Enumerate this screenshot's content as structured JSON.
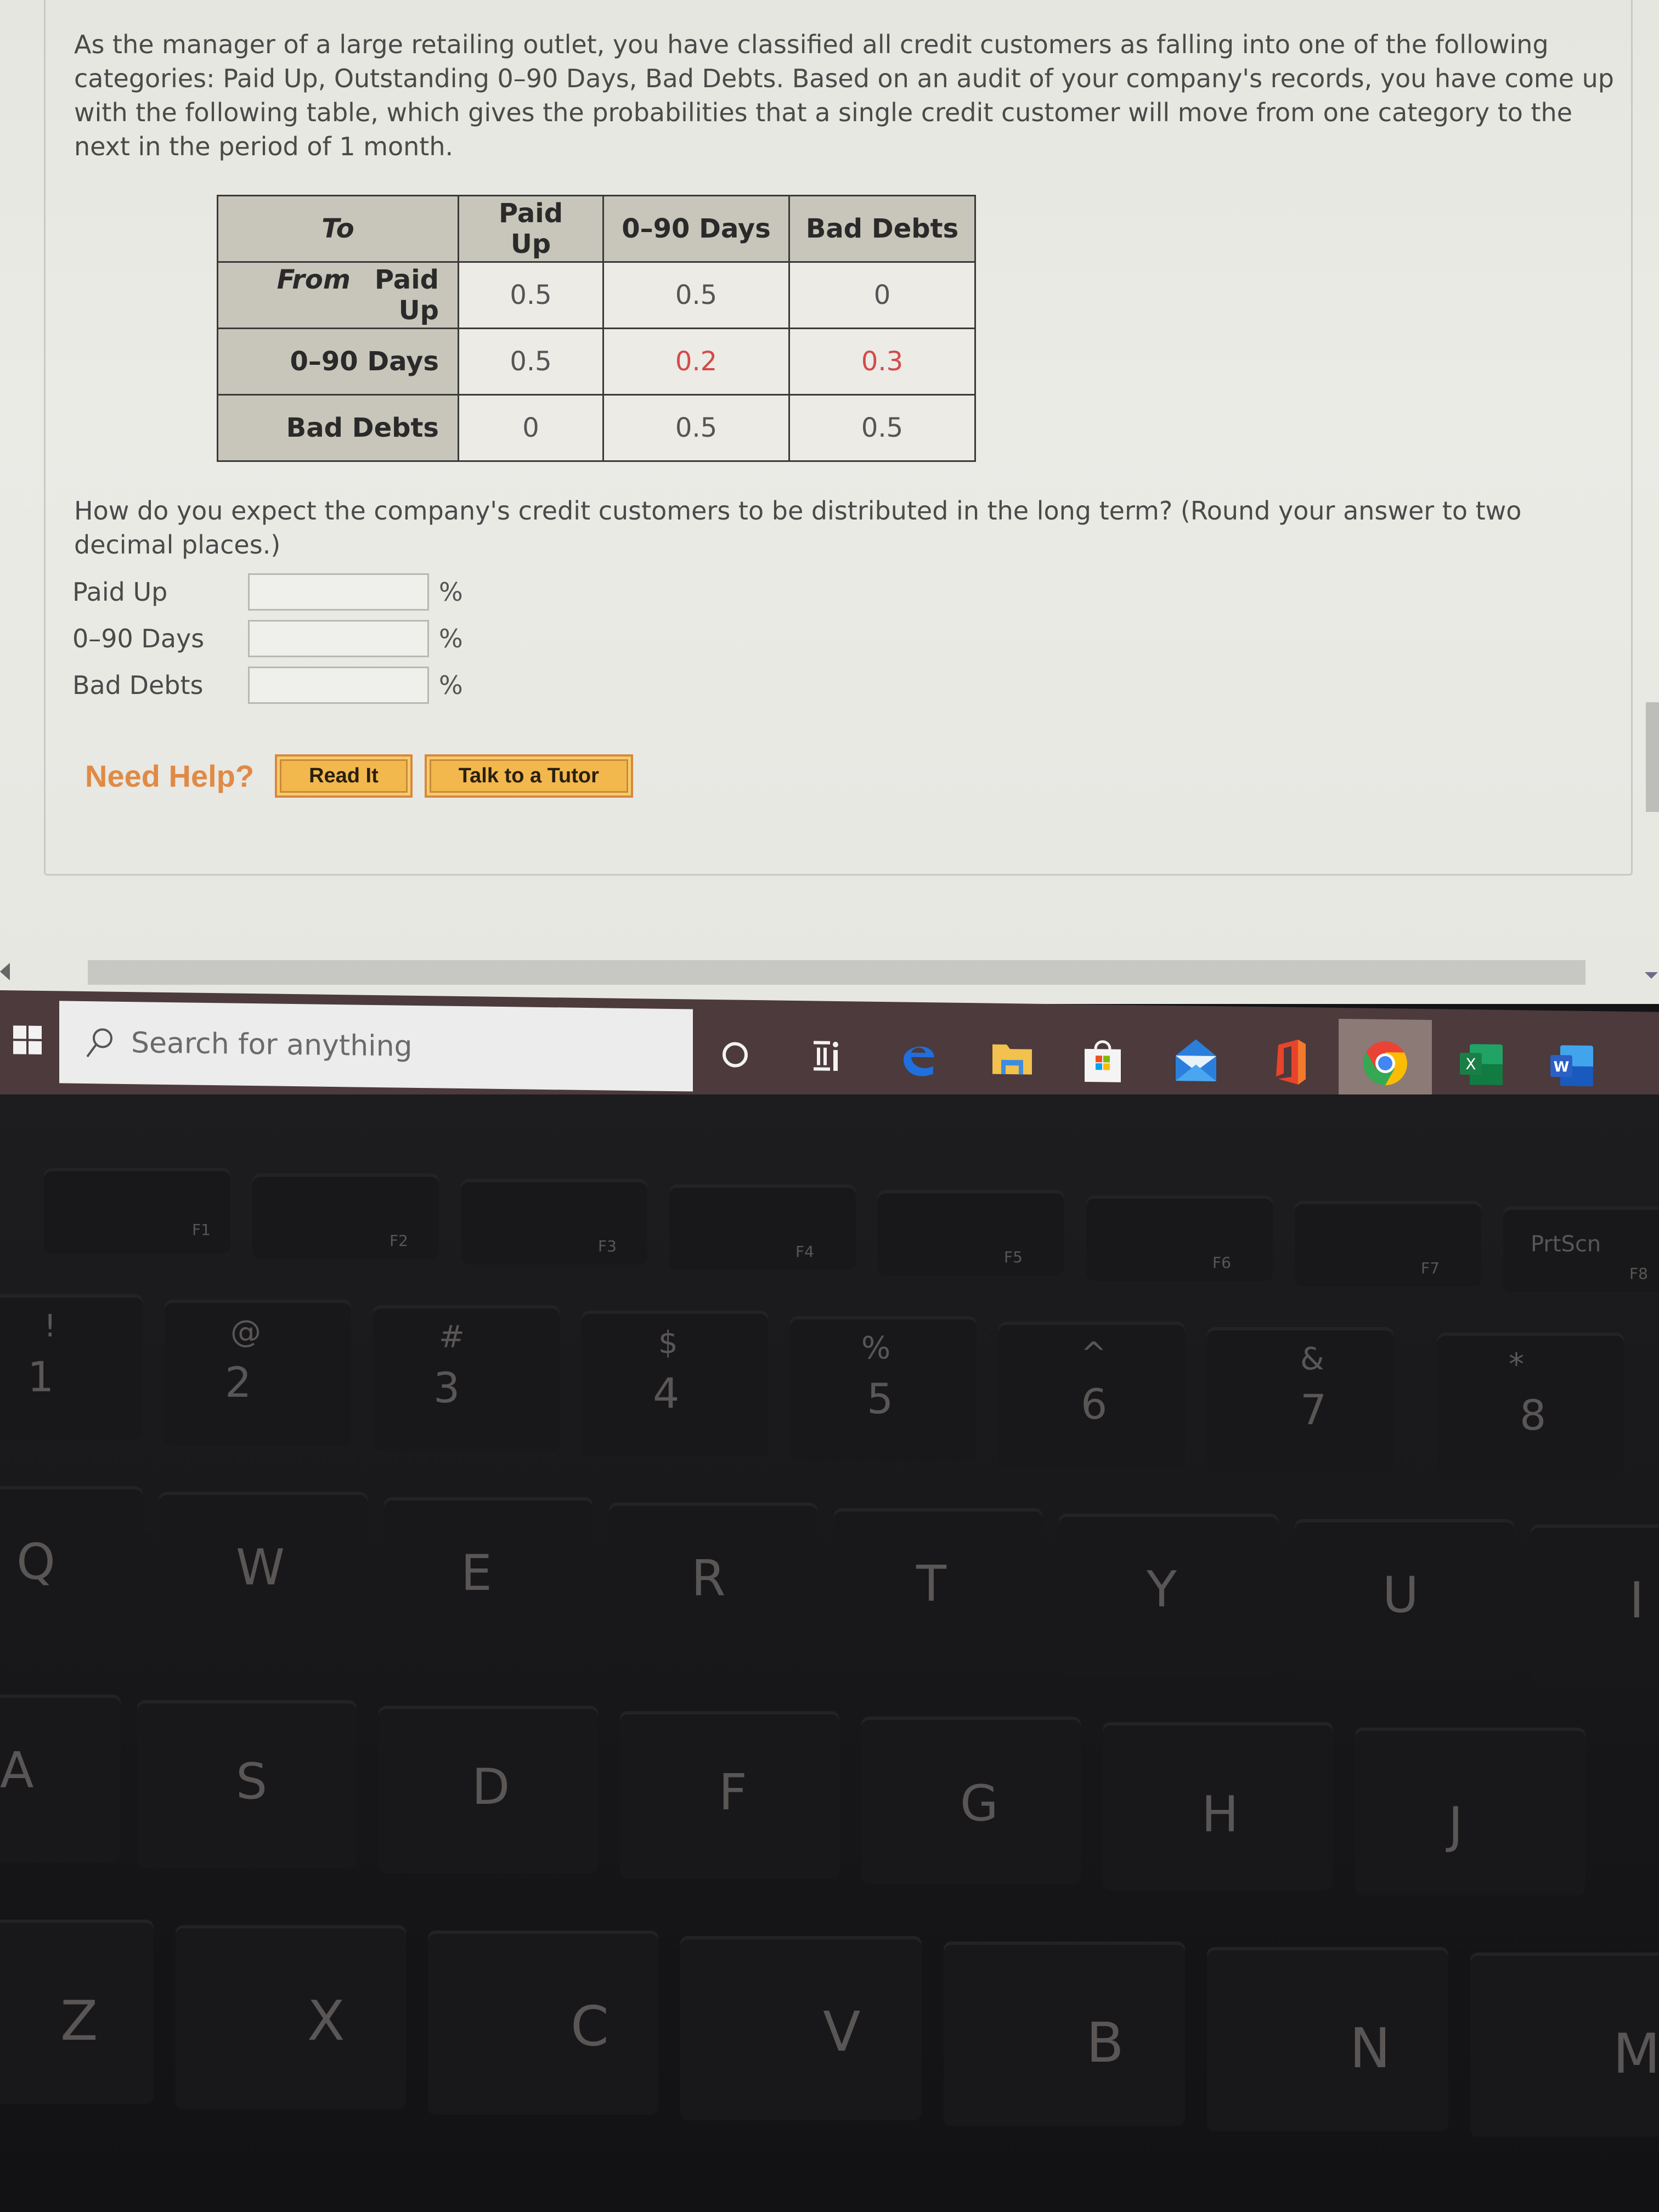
{
  "problem": {
    "intro": "As the manager of a large retailing outlet, you have classified all credit customers as falling into one of the following categories: Paid Up, Outstanding 0–90 Days, Bad Debts. Based on an audit of your company's records, you have come up with the following table, which gives the probabilities that a single credit customer will move from one category to the next in the period of 1 month.",
    "table": {
      "corner_label": "To",
      "from_label": "From",
      "columns": [
        "Paid Up",
        "0–90 Days",
        "Bad Debts"
      ],
      "rows": [
        {
          "label": "Paid Up",
          "values": [
            "0.5",
            "0.5",
            "0"
          ],
          "highlight": [
            false,
            false,
            false
          ]
        },
        {
          "label": "0–90 Days",
          "values": [
            "0.5",
            "0.2",
            "0.3"
          ],
          "highlight": [
            false,
            true,
            true
          ]
        },
        {
          "label": "Bad Debts",
          "values": [
            "0",
            "0.5",
            "0.5"
          ],
          "highlight": [
            false,
            false,
            false
          ]
        }
      ],
      "highlight_color": "#d44a4a"
    },
    "question": "How do you expect the company's credit customers to be distributed in the long term? (Round your answer to two decimal places.)",
    "answers": [
      {
        "label": "Paid Up",
        "value": "",
        "unit": "%"
      },
      {
        "label": "0–90 Days",
        "value": "",
        "unit": "%"
      },
      {
        "label": "Bad Debts",
        "value": "",
        "unit": "%"
      }
    ],
    "help": {
      "label": "Need Help?",
      "buttons": [
        "Read It",
        "Talk to a Tutor"
      ],
      "accent": "#e08a45"
    }
  },
  "taskbar": {
    "search_placeholder": "Search for anything",
    "apps": [
      {
        "name": "cortana",
        "icon": "circle-icon"
      },
      {
        "name": "task-view",
        "icon": "task-view-icon"
      },
      {
        "name": "edge",
        "icon": "edge-icon"
      },
      {
        "name": "file-explorer",
        "icon": "folder-icon"
      },
      {
        "name": "microsoft-store",
        "icon": "store-icon"
      },
      {
        "name": "mail",
        "icon": "mail-icon"
      },
      {
        "name": "office",
        "icon": "office-icon"
      },
      {
        "name": "chrome",
        "icon": "chrome-icon",
        "active": true
      },
      {
        "name": "excel",
        "icon": "excel-icon",
        "letter": "X"
      },
      {
        "name": "word",
        "icon": "word-icon",
        "letter": "W"
      }
    ]
  },
  "keyboard": {
    "fn_row": [
      "F1",
      "F2",
      "F3",
      "F4",
      "F5",
      "F6",
      "F7",
      "PrtScn",
      "F8"
    ],
    "number_row": [
      {
        "top": "!",
        "main": "1"
      },
      {
        "top": "@",
        "main": "2"
      },
      {
        "top": "#",
        "main": "3"
      },
      {
        "top": "$",
        "main": "4"
      },
      {
        "top": "%",
        "main": "5"
      },
      {
        "top": "^",
        "main": "6"
      },
      {
        "top": "&",
        "main": "7"
      },
      {
        "top": "*",
        "main": "8"
      }
    ],
    "qwerty_row": [
      "Q",
      "W",
      "E",
      "R",
      "T",
      "Y",
      "U",
      "I"
    ],
    "home_row": [
      "A",
      "S",
      "D",
      "F",
      "G",
      "H",
      "J"
    ],
    "bottom_row": [
      "Z",
      "X",
      "C",
      "V",
      "B",
      "N",
      "M"
    ]
  }
}
